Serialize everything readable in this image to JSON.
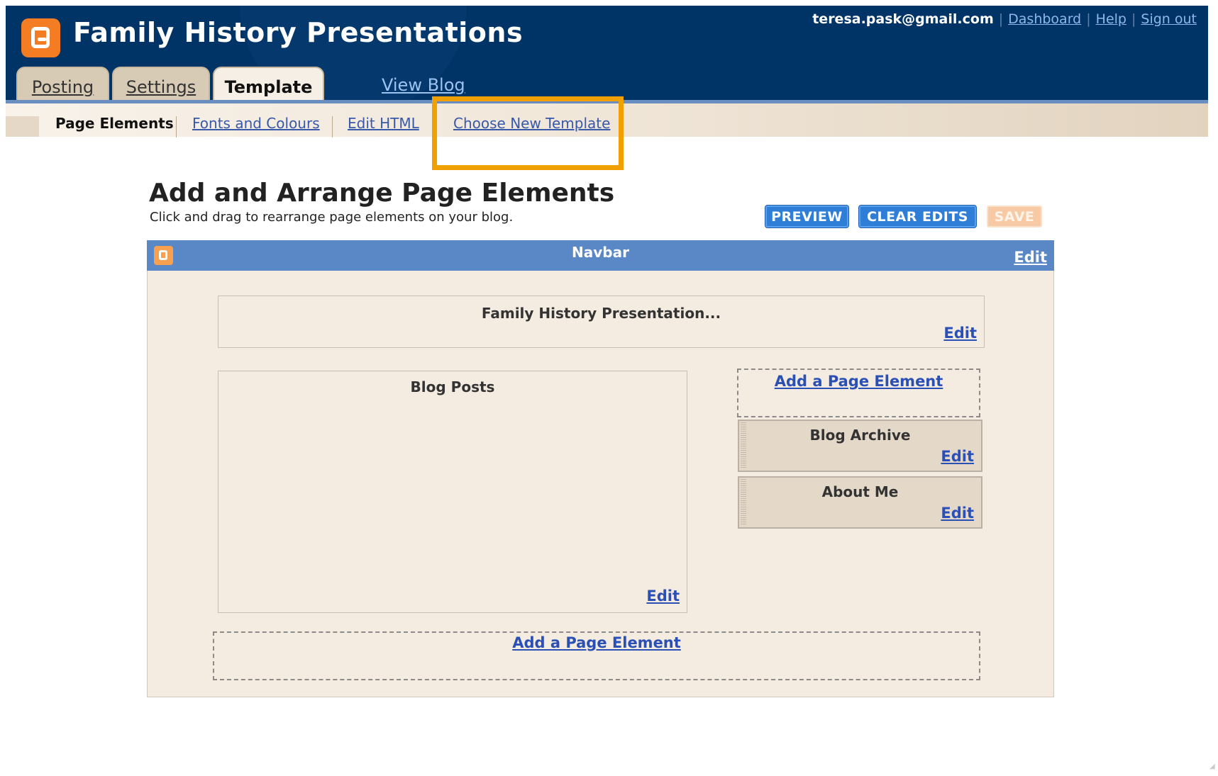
{
  "header": {
    "blog_title": "Family History Presentations",
    "email": "teresa.pask@gmail.com",
    "links": [
      "Dashboard",
      "Help",
      "Sign out"
    ]
  },
  "tabs": {
    "posting": "Posting",
    "settings": "Settings",
    "template": "Template",
    "view_blog": "View Blog"
  },
  "subnav": {
    "page_elements": "Page Elements",
    "fonts": "Fonts and Colours",
    "edit_html": "Edit HTML",
    "choose_template": "Choose New Template"
  },
  "main": {
    "title": "Add and Arrange Page Elements",
    "subtitle": "Click and drag to rearrange page elements on your blog.",
    "buttons": {
      "preview": "PREVIEW",
      "clear": "CLEAR EDITS",
      "save": "SAVE"
    }
  },
  "layout": {
    "navbar_title": "Navbar",
    "header_widget": "Family History Presentation...",
    "blog_posts": "Blog Posts",
    "blog_archive": "Blog Archive",
    "about_me": "About Me",
    "add_element": "Add a Page Element",
    "edit": "Edit"
  },
  "colors": {
    "header_bg": "#003366",
    "accent_orange": "#f47d24",
    "highlight": "#f0a000",
    "navbar_blue": "#5a88c6",
    "link_blue": "#2a4fb5"
  }
}
